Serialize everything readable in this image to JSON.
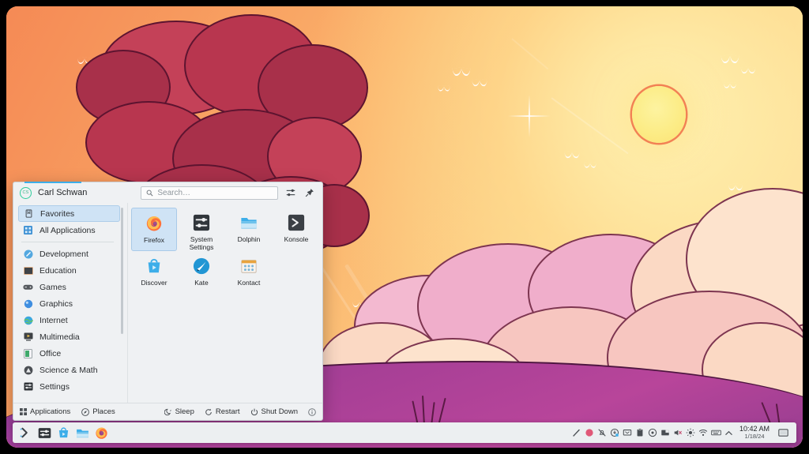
{
  "desktop": {
    "wallpaper_name": "sunset-clouds-wallpaper",
    "colors": {
      "sky_top": "#f58a55",
      "sky_bottom": "#fdecc2",
      "sun": "#fcec86",
      "red_cloud": "#a8304a",
      "pink_cloud": "#f0aecb",
      "hill": "#a63f96",
      "panel_bg": "#eceff1",
      "accent": "#3daee9",
      "selection": "#cfe3f5"
    }
  },
  "launcher": {
    "user": {
      "name": "Carl Schwan",
      "initials": "CS"
    },
    "search": {
      "value": "",
      "placeholder": "Search…"
    },
    "header_buttons": [
      {
        "name": "configure-button",
        "icon": "sliders-icon"
      },
      {
        "name": "pin-button",
        "icon": "pin-icon"
      }
    ],
    "sidebar": {
      "top_items": [
        {
          "label": "Favorites",
          "icon": "bookmark-icon",
          "selected": true
        },
        {
          "label": "All Applications",
          "icon": "grid-icon",
          "selected": false
        }
      ],
      "categories": [
        {
          "label": "Development",
          "icon": "development-icon"
        },
        {
          "label": "Education",
          "icon": "education-icon"
        },
        {
          "label": "Games",
          "icon": "games-icon"
        },
        {
          "label": "Graphics",
          "icon": "graphics-icon"
        },
        {
          "label": "Internet",
          "icon": "internet-icon"
        },
        {
          "label": "Multimedia",
          "icon": "multimedia-icon"
        },
        {
          "label": "Office",
          "icon": "office-icon"
        },
        {
          "label": "Science & Math",
          "icon": "science-icon"
        },
        {
          "label": "Settings",
          "icon": "settings-icon"
        }
      ]
    },
    "apps": [
      {
        "label": "Firefox",
        "icon": "firefox-icon",
        "selected": true
      },
      {
        "label": "System Settings",
        "icon": "system-settings-icon",
        "selected": false
      },
      {
        "label": "Dolphin",
        "icon": "dolphin-icon",
        "selected": false
      },
      {
        "label": "Konsole",
        "icon": "konsole-icon",
        "selected": false
      },
      {
        "label": "Discover",
        "icon": "discover-icon",
        "selected": false
      },
      {
        "label": "Kate",
        "icon": "kate-icon",
        "selected": false
      },
      {
        "label": "Kontact",
        "icon": "kontact-icon",
        "selected": false
      }
    ],
    "footer": {
      "tabs": [
        {
          "label": "Applications",
          "icon": "grid-icon",
          "active": true
        },
        {
          "label": "Places",
          "icon": "compass-icon",
          "active": false
        }
      ],
      "power": [
        {
          "label": "Sleep",
          "icon": "moon-icon"
        },
        {
          "label": "Restart",
          "icon": "restart-icon"
        },
        {
          "label": "Shut Down",
          "icon": "power-icon"
        }
      ],
      "info_button": {
        "name": "about-button",
        "icon": "info-icon"
      }
    }
  },
  "panel": {
    "launcher_button": {
      "name": "application-launcher",
      "icon": "kde-launcher-icon"
    },
    "tasks": [
      {
        "name": "taskbar-system-settings",
        "icon": "system-settings-icon"
      },
      {
        "name": "taskbar-discover",
        "icon": "discover-icon"
      },
      {
        "name": "taskbar-dolphin",
        "icon": "dolphin-icon"
      },
      {
        "name": "taskbar-firefox",
        "icon": "firefox-icon"
      }
    ],
    "tray": [
      {
        "name": "screen-recorder",
        "icon": "pen-icon"
      },
      {
        "name": "record-indicator",
        "icon": "record-dot-icon"
      },
      {
        "name": "notifications",
        "icon": "bell-muted-icon"
      },
      {
        "name": "updates",
        "icon": "update-icon"
      },
      {
        "name": "display-configuration",
        "icon": "display-icon"
      },
      {
        "name": "clipboard",
        "icon": "clipboard-icon"
      },
      {
        "name": "media-player",
        "icon": "media-icon"
      },
      {
        "name": "network-storage",
        "icon": "device-icon"
      },
      {
        "name": "volume",
        "icon": "volume-muted-icon"
      },
      {
        "name": "brightness",
        "icon": "brightness-icon"
      },
      {
        "name": "network",
        "icon": "wifi-icon"
      },
      {
        "name": "keyboard-layout",
        "icon": "keyboard-icon"
      },
      {
        "name": "tray-expand",
        "icon": "chevron-up-icon"
      }
    ],
    "clock": {
      "time": "10:42 AM",
      "date": "1/18/24"
    },
    "peek_button": {
      "name": "show-desktop",
      "icon": "desktop-icon"
    }
  }
}
